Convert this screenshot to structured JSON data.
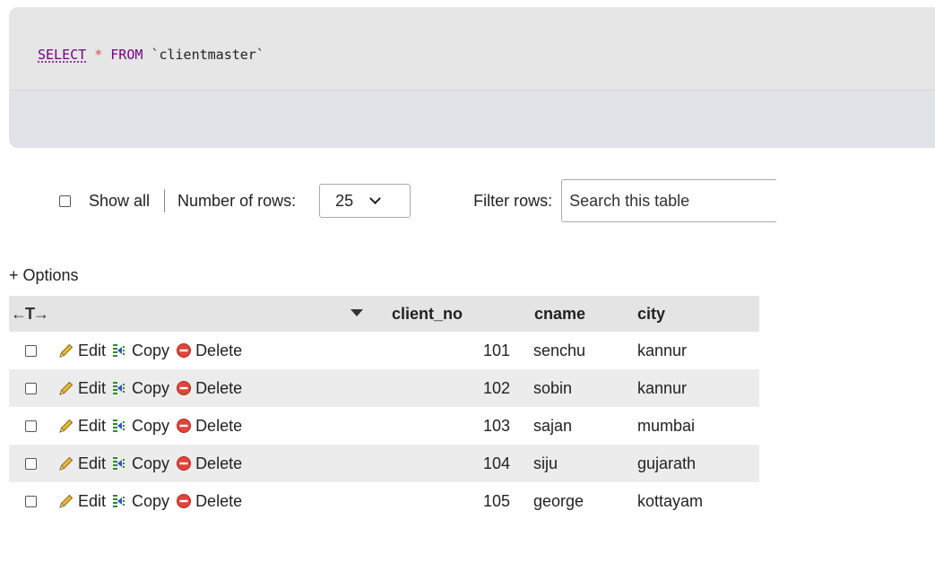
{
  "sql": {
    "keyword_select": "SELECT",
    "star": "*",
    "keyword_from": "FROM",
    "table_ident": "`clientmaster`"
  },
  "controls": {
    "show_all_label": "Show all",
    "rows_label": "Number of rows:",
    "rows_value": "25",
    "filter_label": "Filter rows:",
    "search_placeholder": "Search this table"
  },
  "options_label": "+ Options",
  "table": {
    "nav_arrows": "←T→",
    "columns": [
      "client_no",
      "cname",
      "city"
    ],
    "actions": {
      "edit": "Edit",
      "copy": "Copy",
      "delete": "Delete"
    },
    "rows": [
      {
        "client_no": "101",
        "cname": "senchu",
        "city": "kannur"
      },
      {
        "client_no": "102",
        "cname": "sobin",
        "city": "kannur"
      },
      {
        "client_no": "103",
        "cname": "sajan",
        "city": "mumbai"
      },
      {
        "client_no": "104",
        "cname": "siju",
        "city": "gujarath"
      },
      {
        "client_no": "105",
        "cname": "george",
        "city": "kottayam"
      }
    ]
  },
  "icons": {
    "edit": "pencil-icon",
    "copy": "copy-columns-icon",
    "delete": "delete-circle-icon",
    "sort": "sort-down-triangle-icon"
  },
  "colors": {
    "keyword": "#770088",
    "star": "#e05050",
    "delete_icon": "#e0443a",
    "pencil": "#e8b93a"
  }
}
